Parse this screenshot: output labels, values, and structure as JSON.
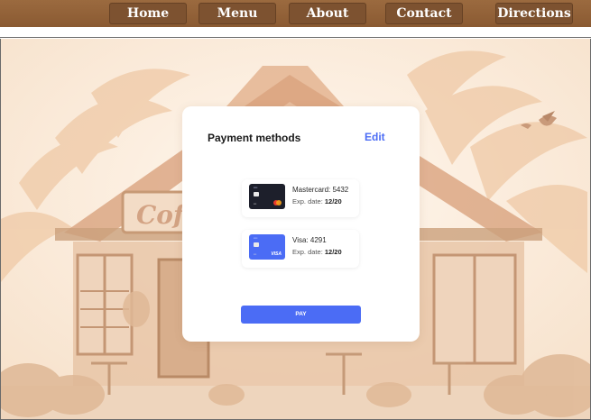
{
  "nav": {
    "items": [
      {
        "label": "Home"
      },
      {
        "label": "Menu"
      },
      {
        "label": "About"
      },
      {
        "label": "Contact"
      },
      {
        "label": "Directions"
      }
    ]
  },
  "background": {
    "sign_text": "Cof"
  },
  "payment": {
    "title": "Payment methods",
    "edit_label": "Edit",
    "methods": [
      {
        "name": "Mastercard: 5432",
        "exp_label": "Exp. date:",
        "exp_value": "12/20",
        "card_color": "#1d1f2b",
        "brand": "mastercard-icon"
      },
      {
        "name": "Visa: 4291",
        "exp_label": "Exp. date:",
        "exp_value": "12/20",
        "card_color": "#4b6cf5",
        "brand": "visa-icon",
        "brand_text": "VISA"
      }
    ],
    "pay_label": "PAY"
  },
  "colors": {
    "accent": "#4b6cf5",
    "nav_bar": "#8a5a32",
    "nav_button": "#7d5230",
    "scene_bg": "#fbeee0"
  }
}
